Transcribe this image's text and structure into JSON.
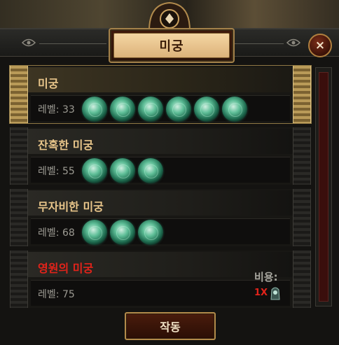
{
  "window": {
    "title": "미궁",
    "close_glyph": "×"
  },
  "labyrinths": [
    {
      "name": "미궁",
      "level_label": "레벨:",
      "level": "33",
      "trials_completed": 6,
      "selected": true
    },
    {
      "name": "잔혹한 미궁",
      "level_label": "레벨:",
      "level": "55",
      "trials_completed": 3,
      "selected": false
    },
    {
      "name": "무자비한 미궁",
      "level_label": "레벨:",
      "level": "68",
      "trials_completed": 3,
      "selected": false
    },
    {
      "name": "영원의 미궁",
      "level_label": "레벨:",
      "level": "75",
      "trials_completed": 0,
      "selected": false
    }
  ],
  "cost": {
    "label": "비용:",
    "quantity": "1X",
    "item_icon": "offering-to-the-goddess-icon"
  },
  "activate_button": "작동",
  "colors": {
    "title_text": "#3a1c08",
    "item_name": "#e8c58a",
    "eternal_name": "#e2231a",
    "level_text": "#9c9a92",
    "frame_gold": "#a3814a"
  }
}
